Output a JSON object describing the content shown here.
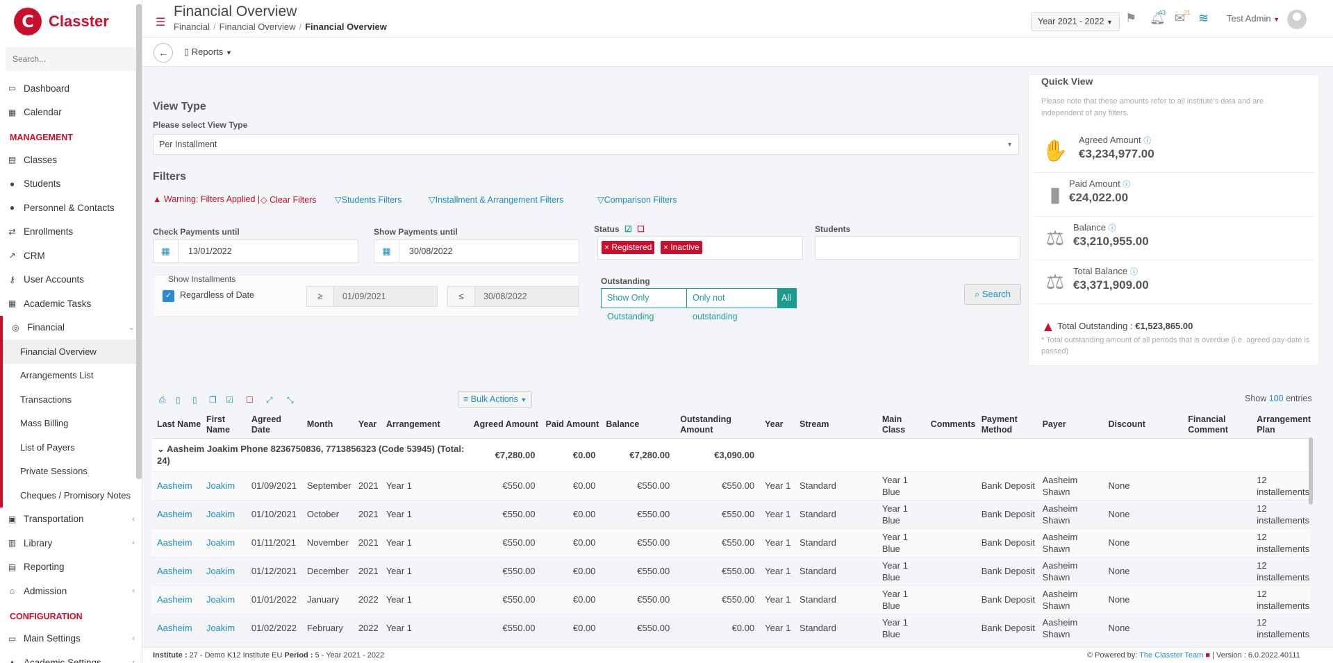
{
  "app": {
    "brand": "Classter",
    "logo_letter": "C"
  },
  "sidebar": {
    "search_placeholder": "Search...",
    "items_top": [
      {
        "label": "Dashboard",
        "icon": "dashboard-icon"
      },
      {
        "label": "Calendar",
        "icon": "calendar-icon"
      }
    ],
    "section_management": "MANAGEMENT",
    "items_mgmt": [
      {
        "label": "Classes"
      },
      {
        "label": "Students"
      },
      {
        "label": "Personnel & Contacts"
      },
      {
        "label": "Enrollments"
      },
      {
        "label": "CRM"
      },
      {
        "label": "User Accounts"
      },
      {
        "label": "Academic Tasks"
      }
    ],
    "financial_label": "Financial",
    "financial_sub": [
      {
        "label": "Financial Overview"
      },
      {
        "label": "Arrangements List"
      },
      {
        "label": "Transactions"
      },
      {
        "label": "Mass Billing"
      },
      {
        "label": "List of Payers"
      },
      {
        "label": "Private Sessions"
      },
      {
        "label": "Cheques / Promisory Notes"
      }
    ],
    "items_after": [
      {
        "label": "Transportation"
      },
      {
        "label": "Library"
      },
      {
        "label": "Reporting"
      },
      {
        "label": "Admission"
      }
    ],
    "section_config": "CONFIGURATION",
    "items_config": [
      {
        "label": "Main Settings"
      },
      {
        "label": "Academic Settings"
      }
    ]
  },
  "header": {
    "title": "Financial Overview",
    "breadcrumb": [
      "Financial",
      "Financial Overview",
      "Financial Overview"
    ],
    "year_selector": "Year 2021 - 2022",
    "notifications_count": "43",
    "messages_count": "21",
    "user_name": "Test Admin"
  },
  "toolbar": {
    "reports_label": "Reports"
  },
  "view_type": {
    "title": "View Type",
    "label": "Please select View Type",
    "selected": "Per Installment"
  },
  "filters": {
    "title": "Filters",
    "warning": "Warning: Filters Applied",
    "clear": "Clear Filters",
    "students_filters": "Students Filters",
    "installment_filters": "Installment & Arrangement Filters",
    "comparison_filters": "Comparison Filters",
    "check_payments_label": "Check Payments until",
    "check_payments_value": "13/01/2022",
    "show_payments_label": "Show Payments until",
    "show_payments_value": "30/08/2022",
    "status_label": "Status",
    "status_tags": [
      "Registered",
      "Inactive"
    ],
    "students_label": "Students",
    "show_installments_label": "Show Installments",
    "regardless_label": "Regardless of Date",
    "gte_symbol": "≥",
    "from_date": "01/09/2021",
    "lte_symbol": "≤",
    "to_date": "30/08/2022",
    "outstanding_label": "Outstanding",
    "outstanding_options": [
      "Show Only Outstanding",
      "Only not outstanding",
      "All"
    ],
    "search_button": "Search"
  },
  "quick_view": {
    "title": "Quick View",
    "note": "Please note that these amounts refer to all institute's data and are independent of any filters.",
    "items": [
      {
        "label": "Agreed Amount",
        "value": "€3,234,977.00",
        "icon": "handshake-icon"
      },
      {
        "label": "Paid Amount",
        "value": "€24,022.00",
        "icon": "bar-chart-icon"
      },
      {
        "label": "Balance",
        "value": "€3,210,955.00",
        "icon": "scale-icon"
      },
      {
        "label": "Total Balance",
        "value": "€3,371,909.00",
        "icon": "scale-icon"
      }
    ],
    "outstanding_label": "Total Outstanding :",
    "outstanding_value": "€1,523,865.00",
    "outstanding_note": "* Total outstanding amount of all periods that is overdue (i.e. agreed pay-date is passed)"
  },
  "table": {
    "bulk_actions": "Bulk Actions",
    "show_label": "Show",
    "show_count": "100",
    "entries_label": "entries",
    "columns": [
      "Last Name",
      "First Name",
      "Agreed Date",
      "Month",
      "Year",
      "Arrangement",
      "Agreed Amount",
      "Paid Amount",
      "Balance",
      "Outstanding Amount",
      "Year",
      "Stream",
      "Main Class",
      "Comments",
      "Payment Method",
      "Payer",
      "Discount",
      "Financial Comment",
      "Arrangement Plan"
    ],
    "group": {
      "label": "Aasheim Joakim Phone 8236750836, 7713856323 (Code 53945) (Total: 24)",
      "agreed": "€7,280.00",
      "paid": "€0.00",
      "balance": "€7,280.00",
      "outstanding": "€3,090.00"
    },
    "rows": [
      [
        "Aasheim",
        "Joakim",
        "01/09/2021",
        "September",
        "2021",
        "Year 1",
        "€550.00",
        "€0.00",
        "€550.00",
        "€550.00",
        "Year 1",
        "Standard",
        "Year 1 Blue",
        "",
        "Bank Deposit",
        "Aasheim Shawn",
        "None",
        "",
        "12 installements"
      ],
      [
        "Aasheim",
        "Joakim",
        "01/10/2021",
        "October",
        "2021",
        "Year 1",
        "€550.00",
        "€0.00",
        "€550.00",
        "€550.00",
        "Year 1",
        "Standard",
        "Year 1 Blue",
        "",
        "Bank Deposit",
        "Aasheim Shawn",
        "None",
        "",
        "12 installements"
      ],
      [
        "Aasheim",
        "Joakim",
        "01/11/2021",
        "November",
        "2021",
        "Year 1",
        "€550.00",
        "€0.00",
        "€550.00",
        "€550.00",
        "Year 1",
        "Standard",
        "Year 1 Blue",
        "",
        "Bank Deposit",
        "Aasheim Shawn",
        "None",
        "",
        "12 installements"
      ],
      [
        "Aasheim",
        "Joakim",
        "01/12/2021",
        "December",
        "2021",
        "Year 1",
        "€550.00",
        "€0.00",
        "€550.00",
        "€550.00",
        "Year 1",
        "Standard",
        "Year 1 Blue",
        "",
        "Bank Deposit",
        "Aasheim Shawn",
        "None",
        "",
        "12 installements"
      ],
      [
        "Aasheim",
        "Joakim",
        "01/01/2022",
        "January",
        "2022",
        "Year 1",
        "€550.00",
        "€0.00",
        "€550.00",
        "€550.00",
        "Year 1",
        "Standard",
        "Year 1 Blue",
        "",
        "Bank Deposit",
        "Aasheim Shawn",
        "None",
        "",
        "12 installements"
      ],
      [
        "Aasheim",
        "Joakim",
        "01/02/2022",
        "February",
        "2022",
        "Year 1",
        "€550.00",
        "€0.00",
        "€550.00",
        "€0.00",
        "Year 1",
        "Standard",
        "Year 1 Blue",
        "",
        "Bank Deposit",
        "Aasheim Shawn",
        "None",
        "",
        "12 installements"
      ]
    ]
  },
  "footer": {
    "institute_label": "Institute :",
    "institute_value": "27 - Demo K12 Institute EU",
    "period_label": "Period :",
    "period_value": "5 - Year 2021 - 2022",
    "powered_label": "Powered by:",
    "powered_link": "The Classter Team",
    "version": "| Version : 6.0.2022.40111"
  },
  "colors": {
    "brand": "#c8102e",
    "link": "#1a8fc0",
    "teal": "#1a9d8f"
  }
}
